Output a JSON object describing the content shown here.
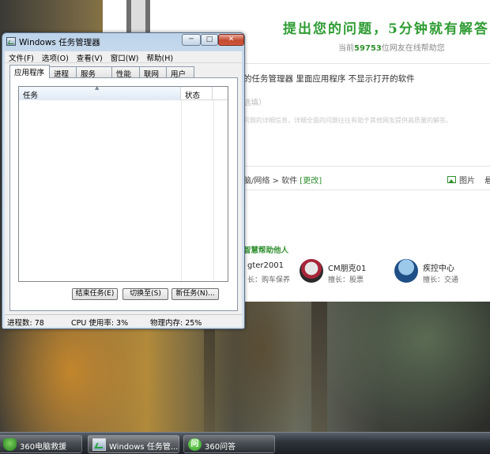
{
  "browser_page": {
    "banner": "提出您的问题，5分钟就有解答",
    "online_prefix": "当前",
    "online_count": "59753",
    "online_suffix": "位网友在线帮助您",
    "question_title": "的任务管理器 里面应用程序 不显示打开的软件",
    "question_sub": "选填）",
    "question_hint": "问题的详细信息，详细全面的问题往往有助于其他网友提供高质量的解答。",
    "category_path": "脑/网络 > 软件",
    "category_edit": "[更改]",
    "picture_label": "图片",
    "anon_label": "悬赏",
    "helpers_title": "智慧帮助他人",
    "helpers": [
      {
        "name": "gter2001",
        "field": "长：购车保养"
      },
      {
        "name": "CM朋克01",
        "field": "擅长：股票"
      },
      {
        "name": "疾控中心",
        "field": "擅长：交通"
      }
    ]
  },
  "task_manager": {
    "title": "Windows 任务管理器",
    "window_buttons": {
      "minimize": "─",
      "maximize": "□",
      "close": "✕"
    },
    "menu": [
      "文件(F)",
      "选项(O)",
      "查看(V)",
      "窗口(W)",
      "帮助(H)"
    ],
    "tabs": [
      "应用程序",
      "进程",
      "服务",
      "性能",
      "联网",
      "用户"
    ],
    "active_tab": "应用程序",
    "columns": {
      "task": "任务",
      "status": "状态"
    },
    "sort_glyph": "▲",
    "buttons": {
      "end_task": "结束任务(E)",
      "switch_to": "切换至(S)",
      "new_task": "新任务(N)..."
    },
    "status": {
      "processes": "进程数: 78",
      "cpu": "CPU 使用率: 3%",
      "memory": "物理内存: 25%"
    }
  },
  "taskbar": {
    "items": [
      {
        "label": "360电脑救援",
        "icon": "shield-icon"
      },
      {
        "label": "Windows 任务管...",
        "icon": "task-manager-icon"
      },
      {
        "label": "360问答",
        "icon": "qa-icon",
        "glyph": "问"
      }
    ]
  },
  "colors": {
    "accent_green": "#2f9c33",
    "title_bar": "#c9dbed",
    "close_button": "#c34a32"
  }
}
